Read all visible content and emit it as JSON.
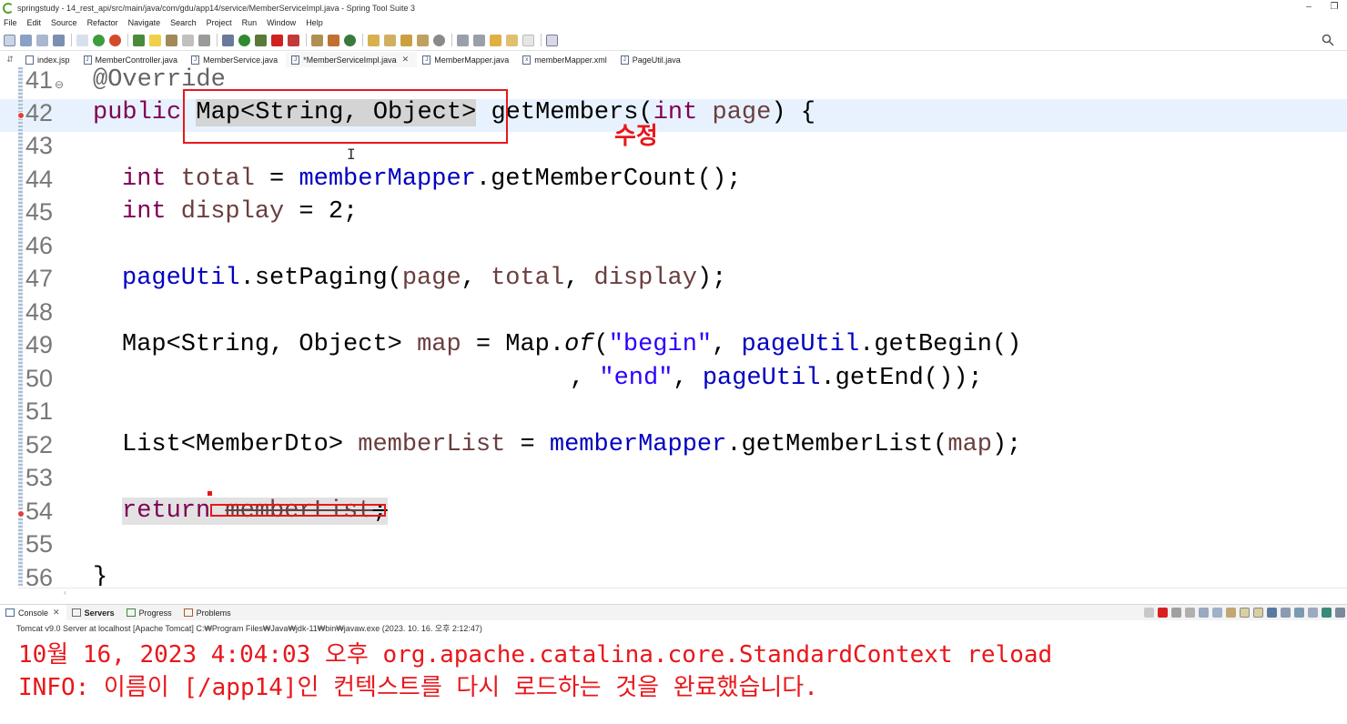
{
  "window": {
    "title": "springstudy - 14_rest_api/src/main/java/com/gdu/app14/service/MemberServiceImpl.java - Spring Tool Suite 3",
    "minimize": "–",
    "restore": "❐"
  },
  "menu": [
    "File",
    "Edit",
    "Source",
    "Refactor",
    "Navigate",
    "Search",
    "Project",
    "Run",
    "Window",
    "Help"
  ],
  "tabs": [
    {
      "label": "index.jsp",
      "icon": "jsp-file-icon"
    },
    {
      "label": "MemberController.java",
      "icon": "java-file-icon"
    },
    {
      "label": "MemberService.java",
      "icon": "java-file-icon"
    },
    {
      "label": "*MemberServiceImpl.java",
      "icon": "java-file-icon",
      "active": true,
      "close": "✕"
    },
    {
      "label": "MemberMapper.java",
      "icon": "java-file-icon"
    },
    {
      "label": "memberMapper.xml",
      "icon": "xml-file-icon"
    },
    {
      "label": "PageUtil.java",
      "icon": "java-file-icon"
    }
  ],
  "editor": {
    "lines": [
      {
        "n": "41",
        "fold": "⊖"
      },
      {
        "n": "42"
      },
      {
        "n": "43"
      },
      {
        "n": "44"
      },
      {
        "n": "45"
      },
      {
        "n": "46"
      },
      {
        "n": "47"
      },
      {
        "n": "48"
      },
      {
        "n": "49"
      },
      {
        "n": "50"
      },
      {
        "n": "51"
      },
      {
        "n": "52"
      },
      {
        "n": "53"
      },
      {
        "n": "54"
      },
      {
        "n": "55"
      },
      {
        "n": "56"
      }
    ],
    "code": {
      "l41": "@Override",
      "l42_kw": "public ",
      "l42_type": "Map<String, Object>",
      "l42_method": " getMembers(",
      "l42_int": "int",
      "l42_param": " page",
      "l42_end": ") {",
      "l44_kw": "int",
      "l44_var": " total",
      "l44_eq": " = ",
      "l44_field": "memberMapper",
      "l44_call": ".getMemberCount();",
      "l45_kw": "int",
      "l45_var": " display",
      "l45_rest": " = 2;",
      "l47_field": "pageUtil",
      "l47_call": ".setPaging(",
      "l47_a1": "page",
      "l47_c1": ", ",
      "l47_a2": "total",
      "l47_c2": ", ",
      "l47_a3": "display",
      "l47_end": ");",
      "l49_type": "Map<String, Object> ",
      "l49_var": "map",
      "l49_eq": " = Map.",
      "l49_of": "of",
      "l49_p": "(",
      "l49_s1": "\"begin\"",
      "l49_c": ", ",
      "l49_field": "pageUtil",
      "l49_call": ".getBegin()",
      "l50_pad": "                ",
      "l50_c": ", ",
      "l50_s2": "\"end\"",
      "l50_c2": ", ",
      "l50_field": "pageUtil",
      "l50_call": ".getEnd());",
      "l52_type": "List<MemberDto> ",
      "l52_var": "memberList",
      "l52_eq": " = ",
      "l52_field": "memberMapper",
      "l52_call": ".getMemberList(",
      "l52_arg": "map",
      "l52_end": ");",
      "l54_kw": "return",
      "l54_sp": " ",
      "l54_var": "memberList",
      "l54_end": ";",
      "l56": "}"
    },
    "annotation": "수정",
    "ibeam": "I"
  },
  "console": {
    "tabs": [
      {
        "label": "Console",
        "close": "✕"
      },
      {
        "label": "Servers"
      },
      {
        "label": "Progress"
      },
      {
        "label": "Problems"
      }
    ],
    "server_line": "Tomcat v9.0 Server at localhost [Apache Tomcat] C:₩Program Files₩Java₩jdk-11₩bin₩javaw.exe  (2023. 10. 16. 오후 2:12:47)",
    "output": [
      "10월 16, 2023 4:04:03 오후 org.apache.catalina.core.StandardContext reload",
      "INFO: 이름이 [/app14]인 컨텍스트를 다시 로드하는 것을 완료했습니다."
    ]
  },
  "colors": {
    "keyword": "#7f0055",
    "field": "#0000c0",
    "string": "#2a00ff",
    "local_var": "#6a3e3e",
    "annotation_red": "#e8171b",
    "current_line": "#e8f2fe"
  }
}
